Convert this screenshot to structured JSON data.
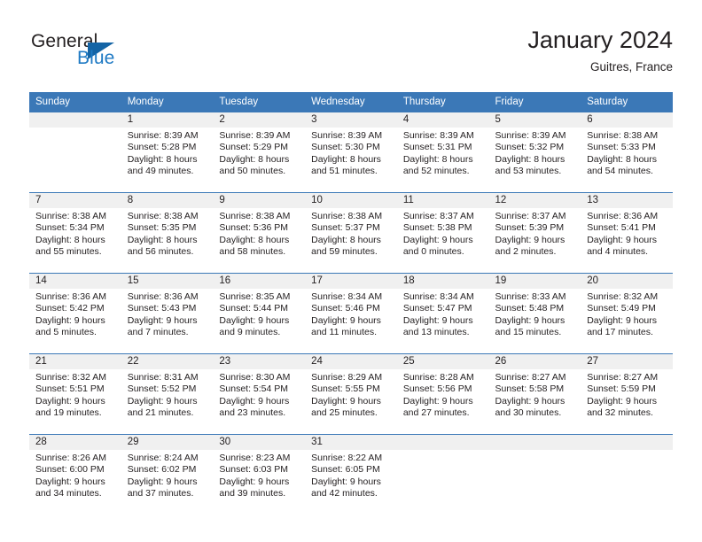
{
  "logo": {
    "primary_text": "General",
    "secondary_text": "Blue",
    "primary_color": "#231f20",
    "secondary_color": "#1f7ac4",
    "triangle_color": "#1464a5",
    "triangle_icon": "triangle-icon"
  },
  "header": {
    "title": "January 2024",
    "location": "Guitres, France"
  },
  "theme": {
    "header_bg": "#3b78b7",
    "header_text": "#ffffff",
    "daynum_band_bg": "#f0f0f0",
    "cell_bg": "#ffffff",
    "text_color": "#231f20",
    "row_divider": "#3b78b7"
  },
  "weekday_headers": [
    "Sunday",
    "Monday",
    "Tuesday",
    "Wednesday",
    "Thursday",
    "Friday",
    "Saturday"
  ],
  "weeks": [
    [
      {
        "day": "",
        "empty": true,
        "sunrise": "",
        "sunset": "",
        "daylight_line1": "",
        "daylight_line2": ""
      },
      {
        "day": "1",
        "sunrise": "Sunrise: 8:39 AM",
        "sunset": "Sunset: 5:28 PM",
        "daylight_line1": "Daylight: 8 hours",
        "daylight_line2": "and 49 minutes."
      },
      {
        "day": "2",
        "sunrise": "Sunrise: 8:39 AM",
        "sunset": "Sunset: 5:29 PM",
        "daylight_line1": "Daylight: 8 hours",
        "daylight_line2": "and 50 minutes."
      },
      {
        "day": "3",
        "sunrise": "Sunrise: 8:39 AM",
        "sunset": "Sunset: 5:30 PM",
        "daylight_line1": "Daylight: 8 hours",
        "daylight_line2": "and 51 minutes."
      },
      {
        "day": "4",
        "sunrise": "Sunrise: 8:39 AM",
        "sunset": "Sunset: 5:31 PM",
        "daylight_line1": "Daylight: 8 hours",
        "daylight_line2": "and 52 minutes."
      },
      {
        "day": "5",
        "sunrise": "Sunrise: 8:39 AM",
        "sunset": "Sunset: 5:32 PM",
        "daylight_line1": "Daylight: 8 hours",
        "daylight_line2": "and 53 minutes."
      },
      {
        "day": "6",
        "sunrise": "Sunrise: 8:38 AM",
        "sunset": "Sunset: 5:33 PM",
        "daylight_line1": "Daylight: 8 hours",
        "daylight_line2": "and 54 minutes."
      }
    ],
    [
      {
        "day": "7",
        "sunrise": "Sunrise: 8:38 AM",
        "sunset": "Sunset: 5:34 PM",
        "daylight_line1": "Daylight: 8 hours",
        "daylight_line2": "and 55 minutes."
      },
      {
        "day": "8",
        "sunrise": "Sunrise: 8:38 AM",
        "sunset": "Sunset: 5:35 PM",
        "daylight_line1": "Daylight: 8 hours",
        "daylight_line2": "and 56 minutes."
      },
      {
        "day": "9",
        "sunrise": "Sunrise: 8:38 AM",
        "sunset": "Sunset: 5:36 PM",
        "daylight_line1": "Daylight: 8 hours",
        "daylight_line2": "and 58 minutes."
      },
      {
        "day": "10",
        "sunrise": "Sunrise: 8:38 AM",
        "sunset": "Sunset: 5:37 PM",
        "daylight_line1": "Daylight: 8 hours",
        "daylight_line2": "and 59 minutes."
      },
      {
        "day": "11",
        "sunrise": "Sunrise: 8:37 AM",
        "sunset": "Sunset: 5:38 PM",
        "daylight_line1": "Daylight: 9 hours",
        "daylight_line2": "and 0 minutes."
      },
      {
        "day": "12",
        "sunrise": "Sunrise: 8:37 AM",
        "sunset": "Sunset: 5:39 PM",
        "daylight_line1": "Daylight: 9 hours",
        "daylight_line2": "and 2 minutes."
      },
      {
        "day": "13",
        "sunrise": "Sunrise: 8:36 AM",
        "sunset": "Sunset: 5:41 PM",
        "daylight_line1": "Daylight: 9 hours",
        "daylight_line2": "and 4 minutes."
      }
    ],
    [
      {
        "day": "14",
        "sunrise": "Sunrise: 8:36 AM",
        "sunset": "Sunset: 5:42 PM",
        "daylight_line1": "Daylight: 9 hours",
        "daylight_line2": "and 5 minutes."
      },
      {
        "day": "15",
        "sunrise": "Sunrise: 8:36 AM",
        "sunset": "Sunset: 5:43 PM",
        "daylight_line1": "Daylight: 9 hours",
        "daylight_line2": "and 7 minutes."
      },
      {
        "day": "16",
        "sunrise": "Sunrise: 8:35 AM",
        "sunset": "Sunset: 5:44 PM",
        "daylight_line1": "Daylight: 9 hours",
        "daylight_line2": "and 9 minutes."
      },
      {
        "day": "17",
        "sunrise": "Sunrise: 8:34 AM",
        "sunset": "Sunset: 5:46 PM",
        "daylight_line1": "Daylight: 9 hours",
        "daylight_line2": "and 11 minutes."
      },
      {
        "day": "18",
        "sunrise": "Sunrise: 8:34 AM",
        "sunset": "Sunset: 5:47 PM",
        "daylight_line1": "Daylight: 9 hours",
        "daylight_line2": "and 13 minutes."
      },
      {
        "day": "19",
        "sunrise": "Sunrise: 8:33 AM",
        "sunset": "Sunset: 5:48 PM",
        "daylight_line1": "Daylight: 9 hours",
        "daylight_line2": "and 15 minutes."
      },
      {
        "day": "20",
        "sunrise": "Sunrise: 8:32 AM",
        "sunset": "Sunset: 5:49 PM",
        "daylight_line1": "Daylight: 9 hours",
        "daylight_line2": "and 17 minutes."
      }
    ],
    [
      {
        "day": "21",
        "sunrise": "Sunrise: 8:32 AM",
        "sunset": "Sunset: 5:51 PM",
        "daylight_line1": "Daylight: 9 hours",
        "daylight_line2": "and 19 minutes."
      },
      {
        "day": "22",
        "sunrise": "Sunrise: 8:31 AM",
        "sunset": "Sunset: 5:52 PM",
        "daylight_line1": "Daylight: 9 hours",
        "daylight_line2": "and 21 minutes."
      },
      {
        "day": "23",
        "sunrise": "Sunrise: 8:30 AM",
        "sunset": "Sunset: 5:54 PM",
        "daylight_line1": "Daylight: 9 hours",
        "daylight_line2": "and 23 minutes."
      },
      {
        "day": "24",
        "sunrise": "Sunrise: 8:29 AM",
        "sunset": "Sunset: 5:55 PM",
        "daylight_line1": "Daylight: 9 hours",
        "daylight_line2": "and 25 minutes."
      },
      {
        "day": "25",
        "sunrise": "Sunrise: 8:28 AM",
        "sunset": "Sunset: 5:56 PM",
        "daylight_line1": "Daylight: 9 hours",
        "daylight_line2": "and 27 minutes."
      },
      {
        "day": "26",
        "sunrise": "Sunrise: 8:27 AM",
        "sunset": "Sunset: 5:58 PM",
        "daylight_line1": "Daylight: 9 hours",
        "daylight_line2": "and 30 minutes."
      },
      {
        "day": "27",
        "sunrise": "Sunrise: 8:27 AM",
        "sunset": "Sunset: 5:59 PM",
        "daylight_line1": "Daylight: 9 hours",
        "daylight_line2": "and 32 minutes."
      }
    ],
    [
      {
        "day": "28",
        "sunrise": "Sunrise: 8:26 AM",
        "sunset": "Sunset: 6:00 PM",
        "daylight_line1": "Daylight: 9 hours",
        "daylight_line2": "and 34 minutes."
      },
      {
        "day": "29",
        "sunrise": "Sunrise: 8:24 AM",
        "sunset": "Sunset: 6:02 PM",
        "daylight_line1": "Daylight: 9 hours",
        "daylight_line2": "and 37 minutes."
      },
      {
        "day": "30",
        "sunrise": "Sunrise: 8:23 AM",
        "sunset": "Sunset: 6:03 PM",
        "daylight_line1": "Daylight: 9 hours",
        "daylight_line2": "and 39 minutes."
      },
      {
        "day": "31",
        "sunrise": "Sunrise: 8:22 AM",
        "sunset": "Sunset: 6:05 PM",
        "daylight_line1": "Daylight: 9 hours",
        "daylight_line2": "and 42 minutes."
      },
      {
        "day": "",
        "empty": true,
        "sunrise": "",
        "sunset": "",
        "daylight_line1": "",
        "daylight_line2": ""
      },
      {
        "day": "",
        "empty": true,
        "sunrise": "",
        "sunset": "",
        "daylight_line1": "",
        "daylight_line2": ""
      },
      {
        "day": "",
        "empty": true,
        "sunrise": "",
        "sunset": "",
        "daylight_line1": "",
        "daylight_line2": ""
      }
    ]
  ]
}
